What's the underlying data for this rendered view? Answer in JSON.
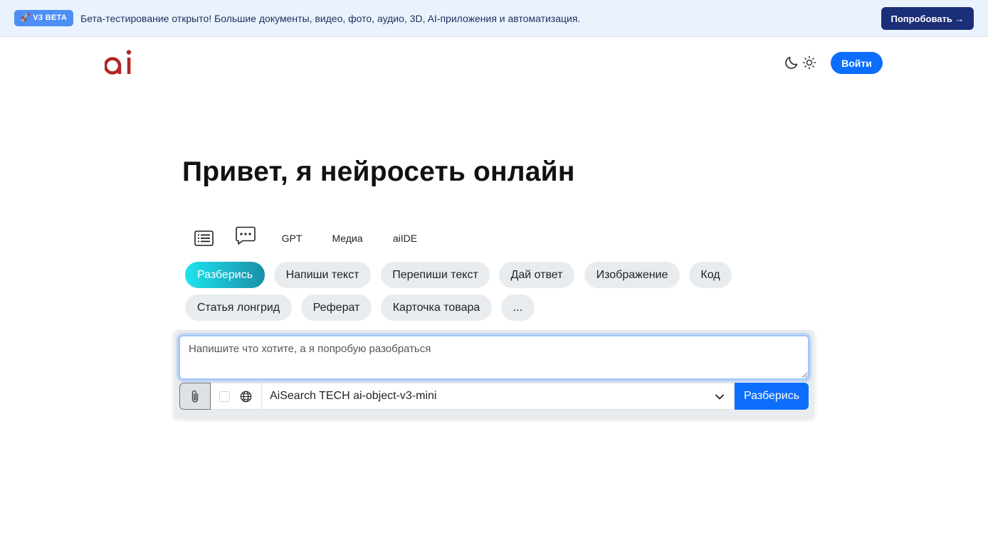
{
  "banner": {
    "badge": "🚀 V3 BETA",
    "text": "Бета-тестирование открыто! Большие документы, видео, фото, аудио, 3D, AI-приложения и автоматизация.",
    "cta": "Попробовать →"
  },
  "header": {
    "logo_text": "ai",
    "logo_color": "#b32424",
    "login_label": "Войти"
  },
  "hero": {
    "title": "Привет, я нейросеть онлайн"
  },
  "modes": {
    "icons": [
      "list-icon",
      "chat-bubble-icon"
    ],
    "gpt": "GPT",
    "media": "Медиа",
    "aiide": "aiIDE"
  },
  "chips": [
    "Разберись",
    "Напиши текст",
    "Перепиши текст",
    "Дай ответ",
    "Изображение",
    "Код",
    "Статья лонгрид",
    "Реферат",
    "Карточка товара",
    "..."
  ],
  "composer": {
    "placeholder": "Напишите что хотите, а я попробую разобраться",
    "value": "",
    "model": "AiSearch TECH ai-object-v3-mini",
    "submit_label": "Разберись",
    "web_search_checked": false
  },
  "colors": {
    "accent": "#0d6efd",
    "banner_bg": "#eaf2fd",
    "cta_bg": "#1b2f78",
    "chip_bg": "#e9ecef",
    "active_chip_gradient": [
      "#1ee3ef",
      "#1a8fa6"
    ]
  }
}
